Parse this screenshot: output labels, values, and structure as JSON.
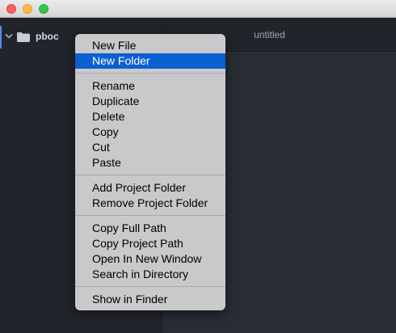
{
  "window": {
    "traffic_lights": [
      "close",
      "minimize",
      "maximize"
    ],
    "colors": {
      "close": "#fc605b",
      "minimize": "#fdbc40",
      "maximize": "#34c84a"
    }
  },
  "sidebar": {
    "root_folder": {
      "label": "pboc",
      "expanded": true,
      "icon": "folder-icon",
      "accent": "#568af2"
    }
  },
  "tabs": [
    {
      "title": "untitled",
      "active": true
    }
  ],
  "context_menu": {
    "highlight_color": "#0b5fd0",
    "items": [
      {
        "label": "New File",
        "highlighted": false
      },
      {
        "label": "New Folder",
        "highlighted": true
      },
      {
        "label": "Rename",
        "highlighted": false
      },
      {
        "label": "Duplicate",
        "highlighted": false
      },
      {
        "label": "Delete",
        "highlighted": false
      },
      {
        "label": "Copy",
        "highlighted": false
      },
      {
        "label": "Cut",
        "highlighted": false
      },
      {
        "label": "Paste",
        "highlighted": false
      },
      {
        "label": "Add Project Folder",
        "highlighted": false
      },
      {
        "label": "Remove Project Folder",
        "highlighted": false
      },
      {
        "label": "Copy Full Path",
        "highlighted": false
      },
      {
        "label": "Copy Project Path",
        "highlighted": false
      },
      {
        "label": "Open In New Window",
        "highlighted": false
      },
      {
        "label": "Search in Directory",
        "highlighted": false
      },
      {
        "label": "Show in Finder",
        "highlighted": false
      }
    ]
  }
}
